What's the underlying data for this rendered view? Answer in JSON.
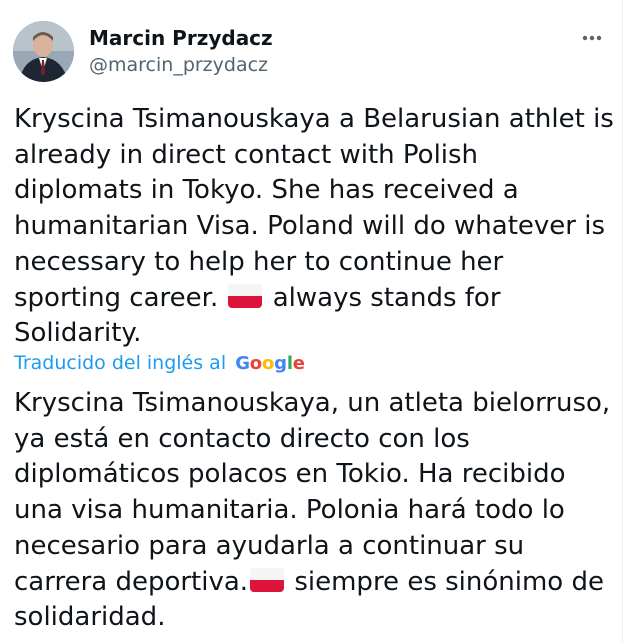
{
  "tweet": {
    "author": {
      "name": "Marcin Przydacz",
      "handle": "@marcin_przydacz"
    },
    "more_icon": "more-horizontal-icon",
    "text_segments": {
      "part1": "Kryscina Tsimanouskaya a Belarusian athlet is already in direct contact with Polish diplomats in Tokyo. She has received a humanitarian Visa. Poland will do whatever is necessary to help her to continue her sporting career.",
      "flag_icon": "poland-flag-icon",
      "part2": "always stands for Solidarity."
    },
    "translation": {
      "label": "Traducido del inglés al",
      "provider": "Google",
      "part1": "Kryscina Tsimanouskaya, un atleta bielorruso, ya está en contacto directo con los diplomáticos polacos en Tokio. Ha recibido una visa humanitaria. Polonia hará todo lo necesario para ayudarla a continuar su carrera deportiva.",
      "part2": "siempre es sinónimo de solidaridad."
    }
  },
  "colors": {
    "text": "#0f1419",
    "secondary": "#536471",
    "link": "#1d9bf0",
    "flag_white": "#f5f5f5",
    "flag_red": "#dc143c",
    "google_blue": "#4285f4",
    "google_red": "#ea4335",
    "google_yellow": "#fbbc05",
    "google_green": "#34a853"
  }
}
